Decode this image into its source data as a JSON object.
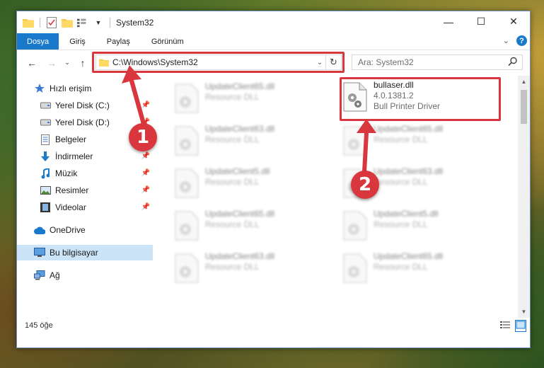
{
  "window": {
    "title": "System32",
    "controls": {
      "minimize": "—",
      "maximize": "☐",
      "close": "✕"
    }
  },
  "ribbon": {
    "tabs": [
      {
        "label": "Dosya",
        "active": true
      },
      {
        "label": "Giriş"
      },
      {
        "label": "Paylaş"
      },
      {
        "label": "Görünüm"
      }
    ],
    "help": "?"
  },
  "address": {
    "path": "C:\\Windows\\System32",
    "search_placeholder": "Ara: System32"
  },
  "sidebar": {
    "items": [
      {
        "label": "Hızlı erişim",
        "icon": "star-icon"
      },
      {
        "label": "Yerel Disk (C:)",
        "icon": "drive-icon",
        "pinned": true
      },
      {
        "label": "Yerel Disk (D:)",
        "icon": "drive-icon",
        "pinned": true
      },
      {
        "label": "Belgeler",
        "icon": "documents-icon",
        "pinned": true
      },
      {
        "label": "İndirmeler",
        "icon": "download-icon",
        "pinned": true
      },
      {
        "label": "Müzik",
        "icon": "music-icon",
        "pinned": true
      },
      {
        "label": "Resimler",
        "icon": "pictures-icon",
        "pinned": true
      },
      {
        "label": "Videolar",
        "icon": "videos-icon",
        "pinned": true
      },
      {
        "label": "OneDrive",
        "icon": "cloud-icon"
      },
      {
        "label": "Bu bilgisayar",
        "icon": "computer-icon",
        "selected": true
      },
      {
        "label": "Ağ",
        "icon": "network-icon"
      }
    ]
  },
  "files": {
    "highlighted": {
      "name": "bullaser.dll",
      "version": "4.0.1381.2",
      "description": "Bull Printer Driver"
    },
    "blurred": [
      {
        "name": "UpdateClient65.dll",
        "desc": "Resource DLL"
      },
      {
        "name": "UpdateClient63.dll",
        "desc": "Resource DLL"
      },
      {
        "name": "UpdateClient65.dll",
        "desc": "Resource DLL"
      },
      {
        "name": "UpdateClient5.dll",
        "desc": "Resource DLL"
      },
      {
        "name": "UpdateClient63.dll",
        "desc": "Resource DLL"
      },
      {
        "name": "UpdateClient65.dll",
        "desc": "Resource DLL"
      },
      {
        "name": "UpdateClient5.dll",
        "desc": "Resource DLL"
      },
      {
        "name": "UpdateClient63.dll",
        "desc": "Resource DLL"
      },
      {
        "name": "UpdateClient65.dll",
        "desc": "Resource DLL"
      }
    ]
  },
  "status": {
    "item_count": "145 öğe"
  },
  "callouts": {
    "one": "1",
    "two": "2"
  },
  "colors": {
    "accent": "#1979ca",
    "highlight": "#d9363e",
    "selected": "#cce4f7"
  }
}
